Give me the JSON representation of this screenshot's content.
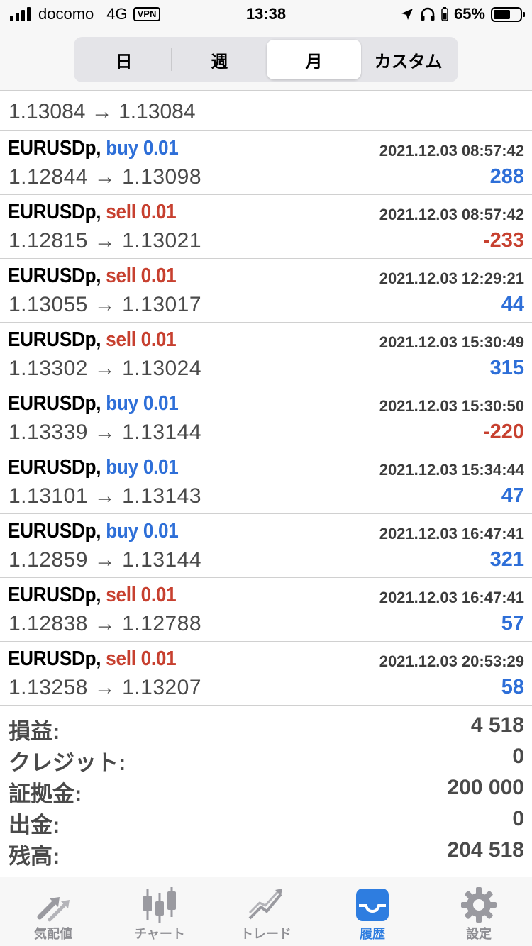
{
  "status_bar": {
    "carrier": "docomo",
    "network": "4G",
    "vpn": "VPN",
    "time": "13:38",
    "battery": "65%"
  },
  "segment": {
    "tabs": [
      {
        "label": "日"
      },
      {
        "label": "週"
      },
      {
        "label": "月"
      },
      {
        "label": "カスタム"
      }
    ],
    "active": "月"
  },
  "partial_row": {
    "prices": "1.13084 → 1.13084"
  },
  "trades": [
    {
      "symbol": "EURUSDp,",
      "side": "buy 0.01",
      "type": "buy",
      "time": "2021.12.03 08:57:42",
      "prices": "1.12844 → 1.13098",
      "profit": "288"
    },
    {
      "symbol": "EURUSDp,",
      "side": "sell 0.01",
      "type": "sell",
      "time": "2021.12.03 08:57:42",
      "prices": "1.12815 → 1.13021",
      "profit": "-233"
    },
    {
      "symbol": "EURUSDp,",
      "side": "sell 0.01",
      "type": "sell",
      "time": "2021.12.03 12:29:21",
      "prices": "1.13055 → 1.13017",
      "profit": "44"
    },
    {
      "symbol": "EURUSDp,",
      "side": "sell 0.01",
      "type": "sell",
      "time": "2021.12.03 15:30:49",
      "prices": "1.13302 → 1.13024",
      "profit": "315"
    },
    {
      "symbol": "EURUSDp,",
      "side": "buy 0.01",
      "type": "buy",
      "time": "2021.12.03 15:30:50",
      "prices": "1.13339 → 1.13144",
      "profit": "-220"
    },
    {
      "symbol": "EURUSDp,",
      "side": "buy 0.01",
      "type": "buy",
      "time": "2021.12.03 15:34:44",
      "prices": "1.13101 → 1.13143",
      "profit": "47"
    },
    {
      "symbol": "EURUSDp,",
      "side": "buy 0.01",
      "type": "buy",
      "time": "2021.12.03 16:47:41",
      "prices": "1.12859 → 1.13144",
      "profit": "321"
    },
    {
      "symbol": "EURUSDp,",
      "side": "sell 0.01",
      "type": "sell",
      "time": "2021.12.03 16:47:41",
      "prices": "1.12838 → 1.12788",
      "profit": "57"
    },
    {
      "symbol": "EURUSDp,",
      "side": "sell 0.01",
      "type": "sell",
      "time": "2021.12.03 20:53:29",
      "prices": "1.13258 → 1.13207",
      "profit": "58"
    }
  ],
  "summary": {
    "profit_label": "損益:",
    "profit_value": "4 518",
    "credit_label": "クレジット:",
    "credit_value": "0",
    "deposit_label": "証拠金:",
    "deposit_value": "200 000",
    "withdrawal_label": "出金:",
    "withdrawal_value": "0",
    "balance_label": "残高:",
    "balance_value": "204 518"
  },
  "tabbar": {
    "items": [
      {
        "label": "気配値",
        "icon": "quotes-arrows-icon"
      },
      {
        "label": "チャート",
        "icon": "candlestick-chart-icon"
      },
      {
        "label": "トレード",
        "icon": "trade-line-icon"
      },
      {
        "label": "履歴",
        "icon": "history-tray-icon"
      },
      {
        "label": "設定",
        "icon": "gear-icon"
      }
    ],
    "active": "履歴"
  },
  "colors": {
    "buy": "#2e6fd8",
    "sell": "#c7402f",
    "active_tab": "#2e7de0",
    "inactive_tab": "#8e8e93"
  }
}
